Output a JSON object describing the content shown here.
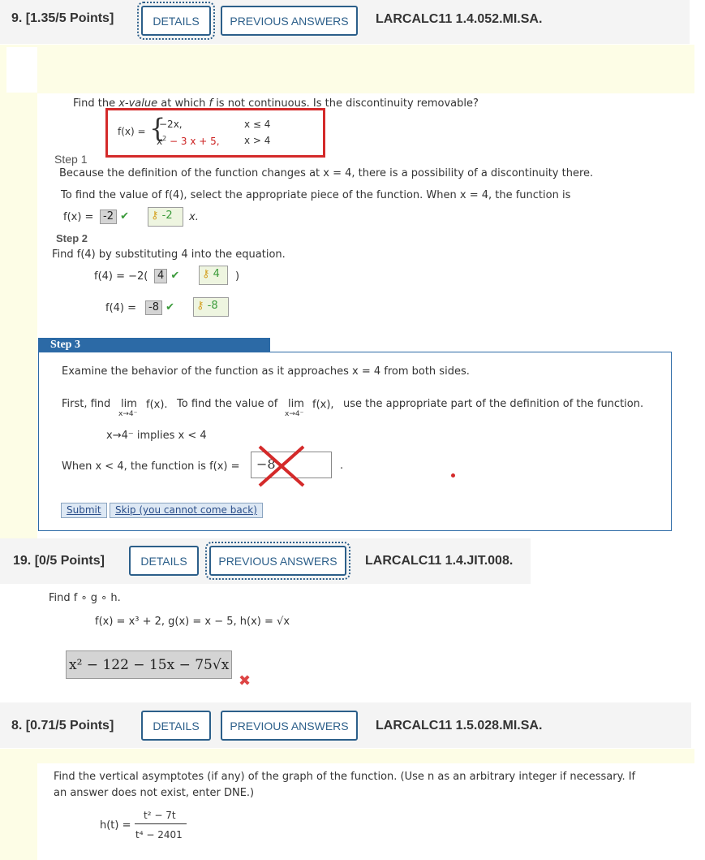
{
  "q9": {
    "number": "9.",
    "points": "[1.35/5 Points]",
    "details": "DETAILS",
    "previous_answers": "PREVIOUS ANSWERS",
    "id": "LARCALC11 1.4.052.MI.SA.",
    "prompt_before": "Find the ",
    "prompt_xvalue": "x-value",
    "prompt_mid": " at which ",
    "prompt_f": "f",
    "prompt_after": " is not continuous. Is the discontinuity removable?",
    "piecewise": {
      "lhs": "f(x) =",
      "row1_expr": "−2x,",
      "row1_cond": "x ≤ 4",
      "row2_expr_pre": "x",
      "row2_expr_sup": "2",
      "row2_expr_post": " − 3 x + 5,",
      "row2_cond": "x > 4"
    },
    "step1": {
      "title": "Step 1",
      "line1": "Because the definition of the function changes at x = 4, there is a possibility of a discontinuity there.",
      "line2": "To find the value of f(4), select the appropriate piece of the function. When x = 4, the function is",
      "fx_label": "f(x) =",
      "answer": "-2",
      "key": "-2",
      "suffix": "x."
    },
    "step2": {
      "title": "Step 2",
      "line1": "Find f(4) by substituting 4 into the equation.",
      "row1_label": "f(4) = −2(",
      "row1_answer": "4",
      "row1_key": "4",
      "row1_close": ")",
      "row2_label": "f(4) =",
      "row2_answer": "-8",
      "row2_key": "-8"
    },
    "step3": {
      "title": "Step 3",
      "line1": "Examine the behavior of the function as it approaches x = 4 from both sides.",
      "first_find": "First, find",
      "lim": "lim",
      "lim_sub": "x→4⁻",
      "fx": "f(x).",
      "to_find": "To find the value of",
      "fx2": "f(x),",
      "use_part": "use the appropriate part of the definition of the function.",
      "implies": "x→4⁻  implies x < 4",
      "when_line": "When x < 4, the function is  f(x) =",
      "entered": "−8",
      "period": ".",
      "submit": "Submit",
      "skip": "Skip (you cannot come back)"
    }
  },
  "q19": {
    "number": "19.",
    "points": "[0/5 Points]",
    "details": "DETAILS",
    "previous_answers": "PREVIOUS ANSWERS",
    "id": "LARCALC11 1.4.JIT.008.",
    "prompt": "Find f ∘ g ∘ h.",
    "functions": "f(x) = x³ + 2,   g(x) = x − 5,   h(x) = √x",
    "answer": "x² − 122 − 15x − 75√x"
  },
  "q8": {
    "number": "8.",
    "points": "[0.71/5 Points]",
    "details": "DETAILS",
    "previous_answers": "PREVIOUS ANSWERS",
    "id": "LARCALC11 1.5.028.MI.SA.",
    "prompt1": "Find the vertical asymptotes (if any) of the graph of the function. (Use n as an arbitrary integer if necessary. If",
    "prompt2": "an answer does not exist, enter DNE.)",
    "ht": "h(t) =",
    "numerator": "t² − 7t",
    "denominator": "t⁴ − 2401"
  },
  "colors": {
    "accent": "#2c5f8a",
    "error": "#cc2222",
    "success": "#3a9a3a",
    "step_header": "#2c6aa6"
  }
}
